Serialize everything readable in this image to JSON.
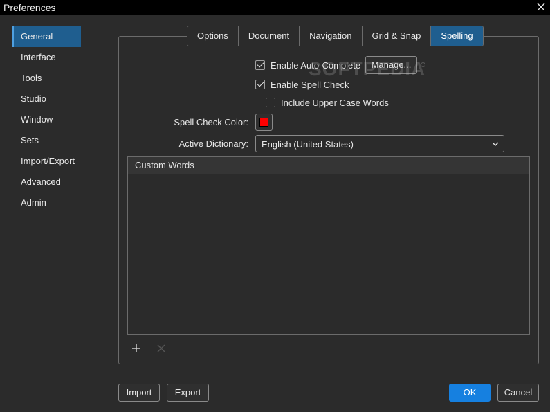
{
  "window": {
    "title": "Preferences"
  },
  "sidebar": {
    "items": [
      {
        "label": "General",
        "active": true
      },
      {
        "label": "Interface"
      },
      {
        "label": "Tools"
      },
      {
        "label": "Studio"
      },
      {
        "label": "Window"
      },
      {
        "label": "Sets"
      },
      {
        "label": "Import/Export"
      },
      {
        "label": "Advanced"
      },
      {
        "label": "Admin"
      }
    ]
  },
  "tabs": [
    {
      "label": "Options"
    },
    {
      "label": "Document"
    },
    {
      "label": "Navigation"
    },
    {
      "label": "Grid & Snap"
    },
    {
      "label": "Spelling",
      "active": true
    }
  ],
  "spelling": {
    "auto_complete": {
      "label": "Enable Auto-Complete",
      "checked": true
    },
    "manage_label": "Manage...",
    "spell_check": {
      "label": "Enable Spell Check",
      "checked": true
    },
    "upper_case": {
      "label": "Include Upper Case Words",
      "checked": false
    },
    "color_label": "Spell Check Color:",
    "color_value": "#ff0000",
    "dictionary_label": "Active Dictionary:",
    "dictionary_value": "English (United States)",
    "custom_words_header": "Custom Words",
    "add_icon": "plus-icon",
    "remove_icon": "x-icon"
  },
  "footer": {
    "import_label": "Import",
    "export_label": "Export",
    "ok_label": "OK",
    "cancel_label": "Cancel"
  },
  "watermark": "SOFTPEDIA",
  "colors": {
    "accent": "#1f5e8f",
    "primary_button": "#1680e0",
    "background": "#2b2b2b"
  }
}
